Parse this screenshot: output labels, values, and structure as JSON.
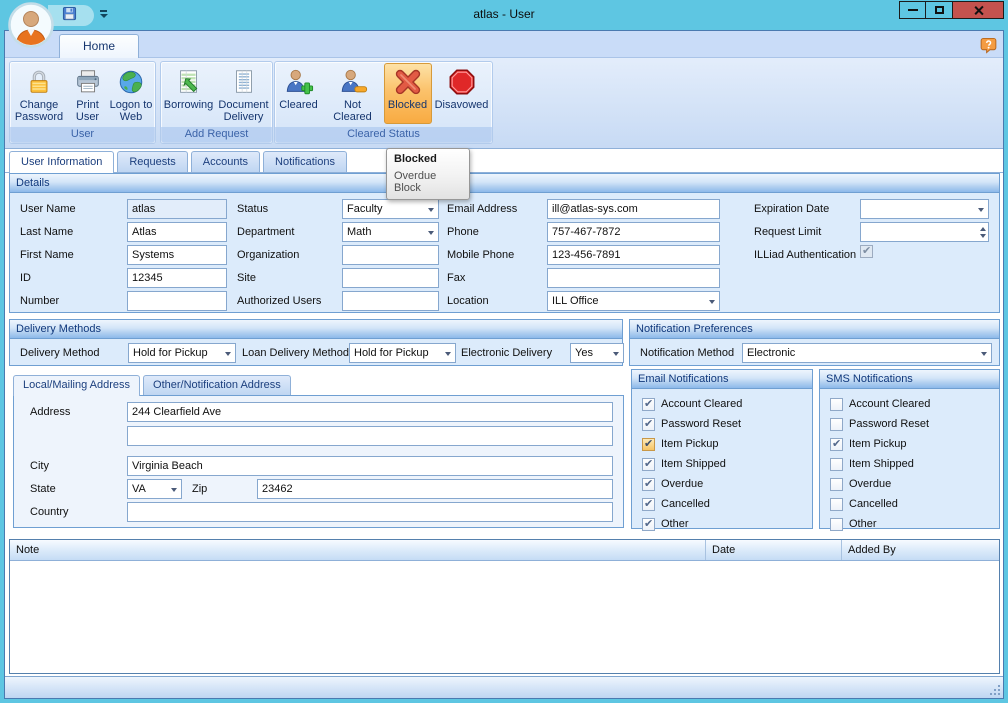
{
  "titlebar": {
    "title": "atlas - User"
  },
  "ribbon": {
    "home_tab": "Home",
    "groups": [
      {
        "label": "User",
        "buttons": [
          {
            "label": "Change Password"
          },
          {
            "label": "Print User"
          },
          {
            "label": "Logon to Web"
          }
        ]
      },
      {
        "label": "Add Request",
        "buttons": [
          {
            "label": "Borrowing"
          },
          {
            "label": "Document Delivery"
          }
        ]
      },
      {
        "label": "Cleared Status",
        "buttons": [
          {
            "label": "Cleared"
          },
          {
            "label": "Not Cleared"
          },
          {
            "label": "Blocked",
            "selected": true
          },
          {
            "label": "Disavowed"
          }
        ]
      }
    ]
  },
  "tooltip": {
    "title": "Blocked",
    "subtitle": "Overdue Block"
  },
  "doc_tabs": [
    {
      "label": "User Information",
      "active": true
    },
    {
      "label": "Requests"
    },
    {
      "label": "Accounts"
    },
    {
      "label": "Notifications"
    }
  ],
  "details": {
    "header": "Details",
    "col1": [
      {
        "label": "User Name",
        "value": "atlas"
      },
      {
        "label": "Last Name",
        "value": "Atlas"
      },
      {
        "label": "First Name",
        "value": "Systems"
      },
      {
        "label": "ID",
        "value": "12345"
      },
      {
        "label": "Number",
        "value": ""
      }
    ],
    "col2": [
      {
        "label": "Status",
        "value": "Faculty"
      },
      {
        "label": "Department",
        "value": "Math"
      },
      {
        "label": "Organization",
        "value": ""
      },
      {
        "label": "Site",
        "value": ""
      },
      {
        "label": "Authorized Users",
        "value": ""
      }
    ],
    "col3": [
      {
        "label": "Email Address",
        "value": "ill@atlas-sys.com"
      },
      {
        "label": "Phone",
        "value": "757-467-7872"
      },
      {
        "label": "Mobile Phone",
        "value": "123-456-7891"
      },
      {
        "label": "Fax",
        "value": ""
      },
      {
        "label": "Location",
        "value": "ILL Office"
      }
    ],
    "col4": [
      {
        "label": "Expiration Date",
        "value": ""
      },
      {
        "label": "Request Limit",
        "value": ""
      },
      {
        "label": "ILLiad Authentication",
        "checked": true
      }
    ]
  },
  "delivery": {
    "header": "Delivery Methods",
    "fields": [
      {
        "label": "Delivery Method",
        "value": "Hold for Pickup"
      },
      {
        "label": "Loan Delivery Method",
        "value": "Hold for Pickup"
      },
      {
        "label": "Electronic Delivery",
        "value": "Yes"
      }
    ]
  },
  "notification_preferences": {
    "header": "Notification Preferences",
    "method_label": "Notification Method",
    "method_value": "Electronic"
  },
  "address": {
    "tabs": [
      {
        "label": "Local/Mailing Address",
        "active": true
      },
      {
        "label": "Other/Notification Address"
      }
    ],
    "address_label": "Address",
    "address1": "244 Clearfield Ave",
    "address2": "",
    "city_label": "City",
    "city": "Virginia Beach",
    "state_label": "State",
    "state": "VA",
    "zip_label": "Zip",
    "zip": "23462",
    "country_label": "Country",
    "country": ""
  },
  "email_notifications": {
    "header": "Email Notifications",
    "items": [
      {
        "label": "Account Cleared",
        "checked": true
      },
      {
        "label": "Password Reset",
        "checked": true
      },
      {
        "label": "Item Pickup",
        "checked": true,
        "focused": true
      },
      {
        "label": "Item Shipped",
        "checked": true
      },
      {
        "label": "Overdue",
        "checked": true
      },
      {
        "label": "Cancelled",
        "checked": true
      },
      {
        "label": "Other",
        "checked": true
      }
    ]
  },
  "sms_notifications": {
    "header": "SMS Notifications",
    "items": [
      {
        "label": "Account Cleared",
        "checked": false
      },
      {
        "label": "Password Reset",
        "checked": false
      },
      {
        "label": "Item Pickup",
        "checked": true
      },
      {
        "label": "Item Shipped",
        "checked": false
      },
      {
        "label": "Overdue",
        "checked": false
      },
      {
        "label": "Cancelled",
        "checked": false
      },
      {
        "label": "Other",
        "checked": false
      }
    ]
  },
  "notes_table": {
    "columns": [
      "Note",
      "Date",
      "Added By"
    ]
  },
  "colors": {
    "titlebar": "#5ec6e2",
    "close_button": "#c4524e",
    "selected_ribbon_button": "#fbc26b",
    "group_header_text": "#10387c",
    "panel_background": "#dcebfb"
  }
}
